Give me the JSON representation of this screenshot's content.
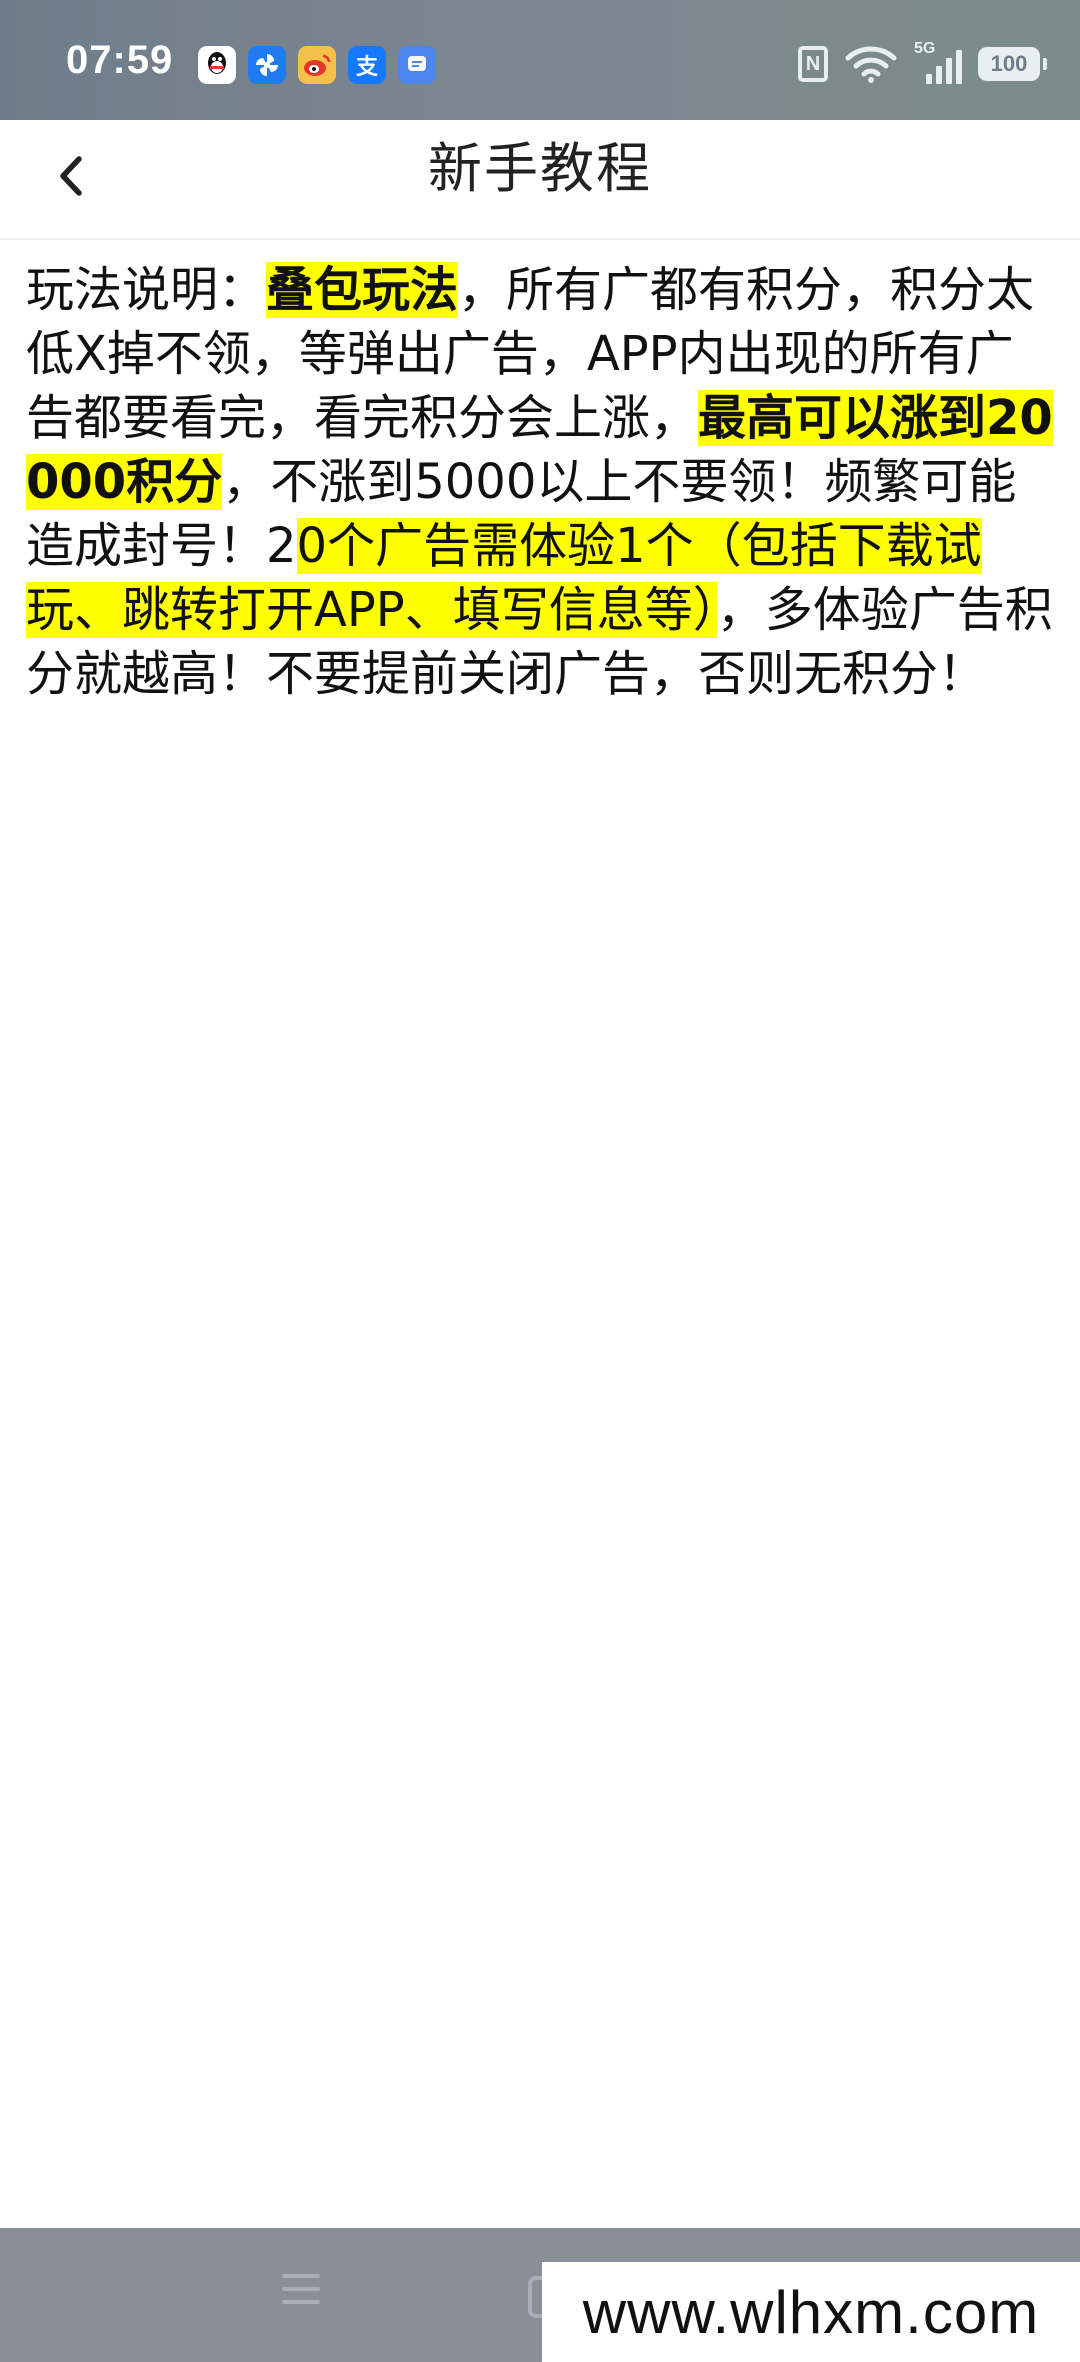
{
  "status_bar": {
    "time": "07:59",
    "notification_icons": [
      "qq-icon",
      "pinwheel-app-icon",
      "weibo-icon",
      "alipay-icon",
      "message-app-icon"
    ],
    "alipay_glyph": "支",
    "nfc_label": "N",
    "network_label": "5G",
    "battery": "100"
  },
  "header": {
    "title": "新手教程"
  },
  "content": {
    "segments": [
      {
        "text": "玩法说明：",
        "highlight": false,
        "bold": false
      },
      {
        "text": "叠包玩法",
        "highlight": true,
        "bold": true
      },
      {
        "text": "，所有广都有积分，积分太低X掉不领，等弹出广告，APP内出现的所有广告都要看完，看完积分会上涨，",
        "highlight": false,
        "bold": false
      },
      {
        "text": "最高可以涨到20000积分",
        "highlight": true,
        "bold": true
      },
      {
        "text": "，不涨到5000以上不要领！频繁可能造成封号！2",
        "highlight": false,
        "bold": false
      },
      {
        "text": "0个广告需体验1个（包括下载试玩、跳转打开APP、填写信息等）",
        "highlight": true,
        "bold": false
      },
      {
        "text": "，多体验广告积分就越高！不要提前关闭广告，否则无积分！",
        "highlight": false,
        "bold": false
      }
    ]
  },
  "watermark": "www.wlhxm.com",
  "colors": {
    "highlight": "#ffff00",
    "status_bar": "#77838d",
    "nav_bar": "#8a8e96"
  }
}
